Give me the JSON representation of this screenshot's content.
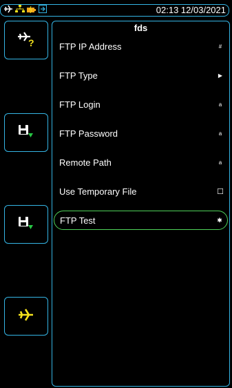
{
  "status": {
    "time": "02:13 12/03/2021",
    "icons": [
      "airplane-icon",
      "network-icon",
      "battery-icon",
      "usb-icon"
    ]
  },
  "softkeys": [
    {
      "icon": "airplane-question-icon"
    },
    {
      "icon": "save-download-icon"
    },
    {
      "icon": "save-download-icon"
    },
    {
      "icon": "airplane-icon"
    }
  ],
  "panel": {
    "title": "fds",
    "items": [
      {
        "label": "FTP IP Address",
        "indicator": "#"
      },
      {
        "label": "FTP Type",
        "indicator": "▶"
      },
      {
        "label": "FTP Login",
        "indicator": "a"
      },
      {
        "label": "FTP Password",
        "indicator": "a"
      },
      {
        "label": "Remote Path",
        "indicator": "a"
      },
      {
        "label": "Use Temporary File",
        "indicator": "☐"
      },
      {
        "label": "FTP Test",
        "indicator": "✱"
      }
    ]
  },
  "colors": {
    "border": "#35b6e6",
    "active": "#4fd35a",
    "yellow": "#f4e21c",
    "green": "#27c744"
  }
}
